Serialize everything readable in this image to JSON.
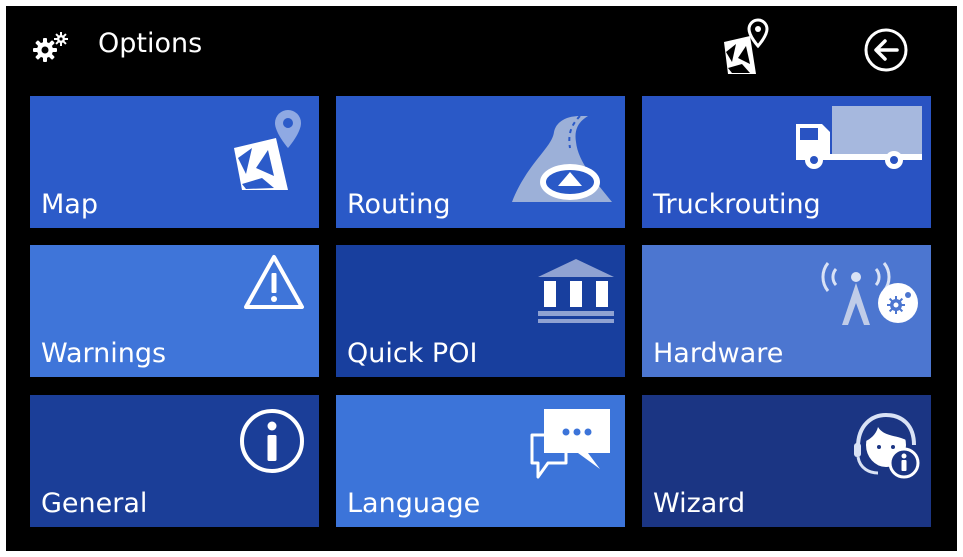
{
  "header": {
    "title": "Options",
    "title_icon": "gear-icon",
    "map_button_icon": "map-icon",
    "back_button_icon": "back-arrow-icon"
  },
  "tiles": [
    {
      "label": "Map",
      "icon": "map-icon",
      "color": "#2C5BC9"
    },
    {
      "label": "Routing",
      "icon": "road-icon",
      "color": "#2A59C7"
    },
    {
      "label": "Truckrouting",
      "icon": "truck-icon",
      "color": "#2953C2"
    },
    {
      "label": "Warnings",
      "icon": "warning-icon",
      "color": "#3F75D9"
    },
    {
      "label": "Quick POI",
      "icon": "poi-building-icon",
      "color": "#183F9E"
    },
    {
      "label": "Hardware",
      "icon": "hardware-signal-icon",
      "color": "#4C76D0"
    },
    {
      "label": "General",
      "icon": "info-icon",
      "color": "#1B3E98"
    },
    {
      "label": "Language",
      "icon": "speech-bubbles-icon",
      "color": "#3C74D9"
    },
    {
      "label": "Wizard",
      "icon": "wizard-assistant-icon",
      "color": "#1B3583"
    }
  ],
  "colors": {
    "background": "#000000",
    "icon": "#FFFFFF"
  }
}
